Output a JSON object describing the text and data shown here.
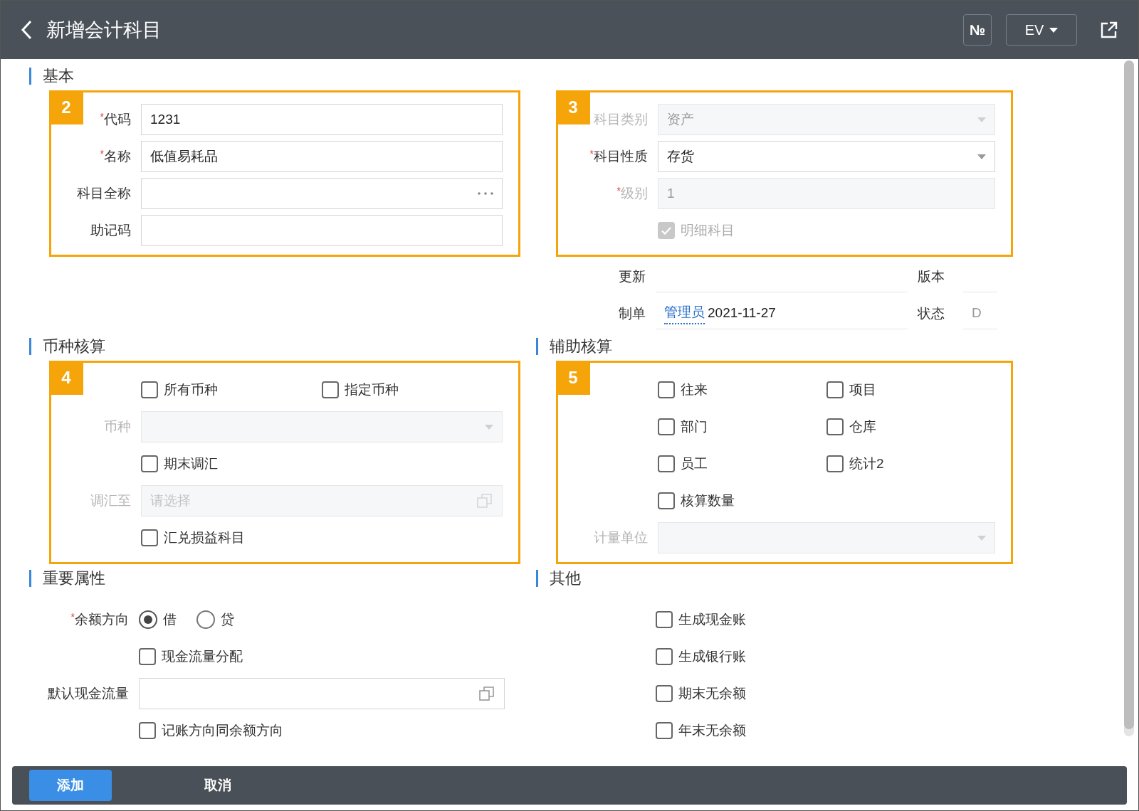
{
  "header": {
    "title": "新增会计科目",
    "number_button": "№",
    "language": "EV"
  },
  "rows": [
    {
      "left": {
        "heading": "基本",
        "annotation": "2",
        "items": [
          {
            "kind": "input",
            "label": "代码",
            "required_mark": "*",
            "value": "1231"
          },
          {
            "kind": "input",
            "label": "名称",
            "required_mark": "*",
            "value": "低值易耗品"
          },
          {
            "kind": "ellipsis",
            "label": "科目全称"
          },
          {
            "kind": "input",
            "label": "助记码"
          }
        ]
      },
      "right": {
        "annotation": "3",
        "items": [
          {
            "kind": "select",
            "label": "科目类别",
            "disabled": true,
            "value": "资产"
          },
          {
            "kind": "select",
            "label": "科目性质",
            "required_mark": "*",
            "value": "存货"
          },
          {
            "kind": "input",
            "label": "级别",
            "required_mark": "*",
            "disabled": true,
            "value": "1"
          },
          {
            "kind": "checks",
            "options": [
              {
                "label": "明细科目",
                "checked": true,
                "disabled": true
              }
            ]
          }
        ],
        "extra_items": [
          {
            "kind": "info",
            "label": "更新",
            "side_label": "版本"
          },
          {
            "kind": "info",
            "label": "制单",
            "link": "管理员",
            "value": "2021-11-27",
            "side_label": "状态",
            "side_value": "D"
          }
        ]
      }
    },
    {
      "left": {
        "heading": "币种核算",
        "annotation": "4",
        "items": [
          {
            "kind": "checks",
            "options": [
              {
                "label": "所有币种",
                "checked": false
              },
              {
                "label": "指定币种",
                "checked": false
              }
            ]
          },
          {
            "kind": "select",
            "label": "币种",
            "disabled": true
          },
          {
            "kind": "checks",
            "options": [
              {
                "label": "期末调汇",
                "checked": false
              }
            ]
          },
          {
            "kind": "picker",
            "label": "调汇至",
            "disabled": true,
            "placeholder": "请选择"
          },
          {
            "kind": "checks",
            "options": [
              {
                "label": "汇兑损益科目",
                "checked": false
              }
            ]
          }
        ]
      },
      "right": {
        "heading": "辅助核算",
        "annotation": "5",
        "items": [
          {
            "kind": "checks",
            "options": [
              {
                "label": "往来",
                "checked": false
              },
              {
                "label": "项目",
                "checked": false
              }
            ]
          },
          {
            "kind": "checks",
            "options": [
              {
                "label": "部门",
                "checked": false
              },
              {
                "label": "仓库",
                "checked": false
              }
            ]
          },
          {
            "kind": "checks",
            "options": [
              {
                "label": "员工",
                "checked": false
              },
              {
                "label": "统计2",
                "checked": false
              }
            ]
          },
          {
            "kind": "checks",
            "options": [
              {
                "label": "核算数量",
                "checked": false
              }
            ]
          },
          {
            "kind": "select",
            "label": "计量单位",
            "disabled": true
          }
        ]
      }
    },
    {
      "left": {
        "heading": "重要属性",
        "items": [
          {
            "kind": "radio",
            "label": "余额方向",
            "required_mark": "*",
            "options": [
              {
                "label": "借",
                "selected": true
              },
              {
                "label": "贷",
                "selected": false
              }
            ]
          },
          {
            "kind": "checks",
            "options": [
              {
                "label": "现金流量分配",
                "checked": false
              }
            ]
          },
          {
            "kind": "picker",
            "label": "默认现金流量"
          },
          {
            "kind": "checks",
            "options": [
              {
                "label": "记账方向同余额方向",
                "checked": false
              }
            ]
          }
        ]
      },
      "right": {
        "heading": "其他",
        "items": [
          {
            "kind": "checks",
            "options": [
              {
                "label": "生成现金账",
                "checked": false
              }
            ]
          },
          {
            "kind": "checks",
            "options": [
              {
                "label": "生成银行账",
                "checked": false
              }
            ]
          },
          {
            "kind": "checks",
            "options": [
              {
                "label": "期末无余额",
                "checked": false
              }
            ]
          },
          {
            "kind": "checks",
            "options": [
              {
                "label": "年末无余额",
                "checked": false
              }
            ]
          }
        ]
      }
    }
  ],
  "footer": {
    "primary": "添加",
    "secondary": "取消"
  }
}
